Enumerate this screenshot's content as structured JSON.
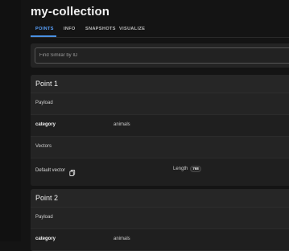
{
  "page": {
    "title": "my-collection"
  },
  "tabs": [
    {
      "label": "POINTS",
      "active": true
    },
    {
      "label": "INFO",
      "active": false
    },
    {
      "label": "SNAPSHOTS",
      "active": false
    },
    {
      "label": "VISUALIZE",
      "active": false
    }
  ],
  "search": {
    "placeholder": "Find Similar by ID",
    "value": ""
  },
  "points": [
    {
      "title": "Point 1",
      "payload_label": "Payload",
      "payload": [
        {
          "key": "category",
          "value": "animals"
        }
      ],
      "vectors_label": "Vectors",
      "vectors": [
        {
          "name": "Default vector",
          "length_label": "Length",
          "length": "768",
          "icon": "copy-icon"
        }
      ]
    },
    {
      "title": "Point 2",
      "payload_label": "Payload",
      "payload": [
        {
          "key": "category",
          "value": "animals"
        }
      ]
    }
  ],
  "colors": {
    "background": "#141414",
    "card": "#212121",
    "accent": "#4a90e2",
    "active_tab": "#5aa3ff"
  }
}
